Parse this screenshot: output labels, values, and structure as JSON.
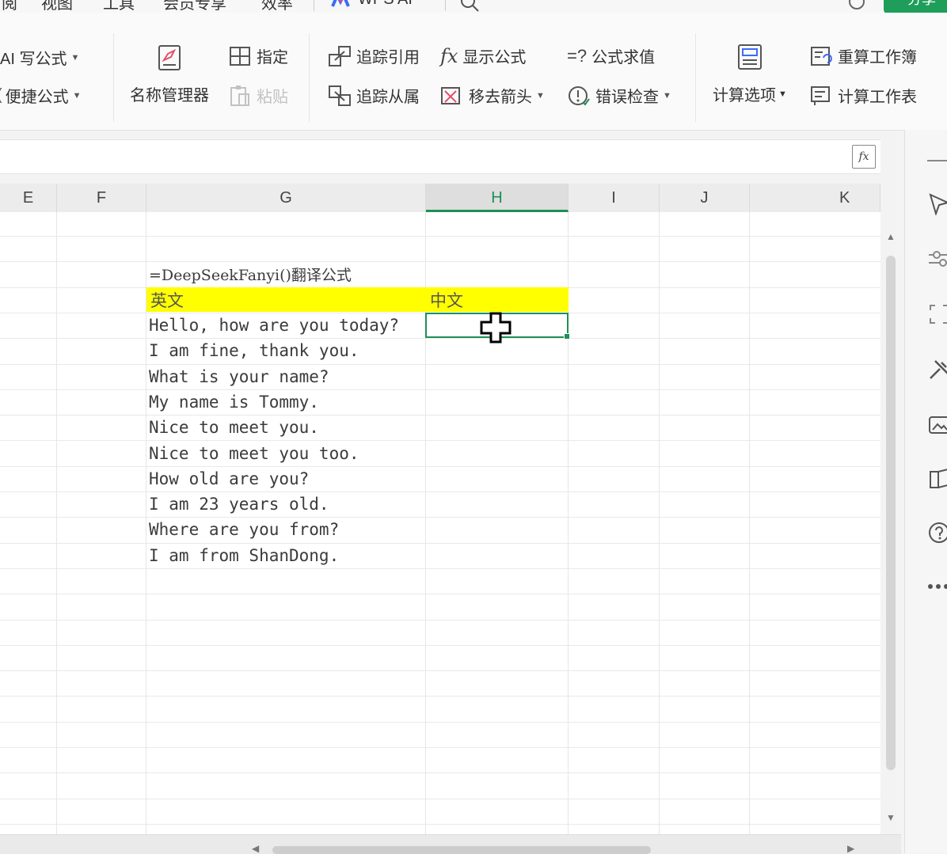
{
  "menu": {
    "items": [
      "阅",
      "视图",
      "工具",
      "会员专享",
      "效率",
      "WPS AI"
    ],
    "share_label": "分享"
  },
  "ribbon": {
    "ai_formula": "AI 写公式",
    "quick_formula": "便捷公式",
    "name_manager": "名称管理器",
    "specify": "指定",
    "paste": "粘贴",
    "trace_precedents": "追踪引用",
    "trace_dependents": "追踪从属",
    "show_formulas": "显示公式",
    "remove_arrows": "移去箭头",
    "evaluate_formula": "公式求值",
    "error_check": "错误检查",
    "calc_options": "计算选项",
    "recalc_workbook": "重算工作簿",
    "calc_sheet": "计算工作表"
  },
  "columns": [
    "E",
    "F",
    "G",
    "H",
    "I",
    "J",
    "K"
  ],
  "active_column": "H",
  "sheet": {
    "formula_note": "=DeepSeekFanyi()翻译公式",
    "header_en": "英文",
    "header_zh": "中文",
    "highlight_color": "#ffff00",
    "sentences": [
      "Hello, how are you today?",
      "I am fine, thank you.",
      "What is your name?",
      "My name is Tommy.",
      "Nice to meet you.",
      "Nice to meet you too.",
      "How old are you?",
      "I am 23 years old.",
      "Where are you from?",
      "I am from ShanDong."
    ]
  },
  "colors": {
    "accent": "#1e8f58",
    "share": "#1f9e5a"
  }
}
